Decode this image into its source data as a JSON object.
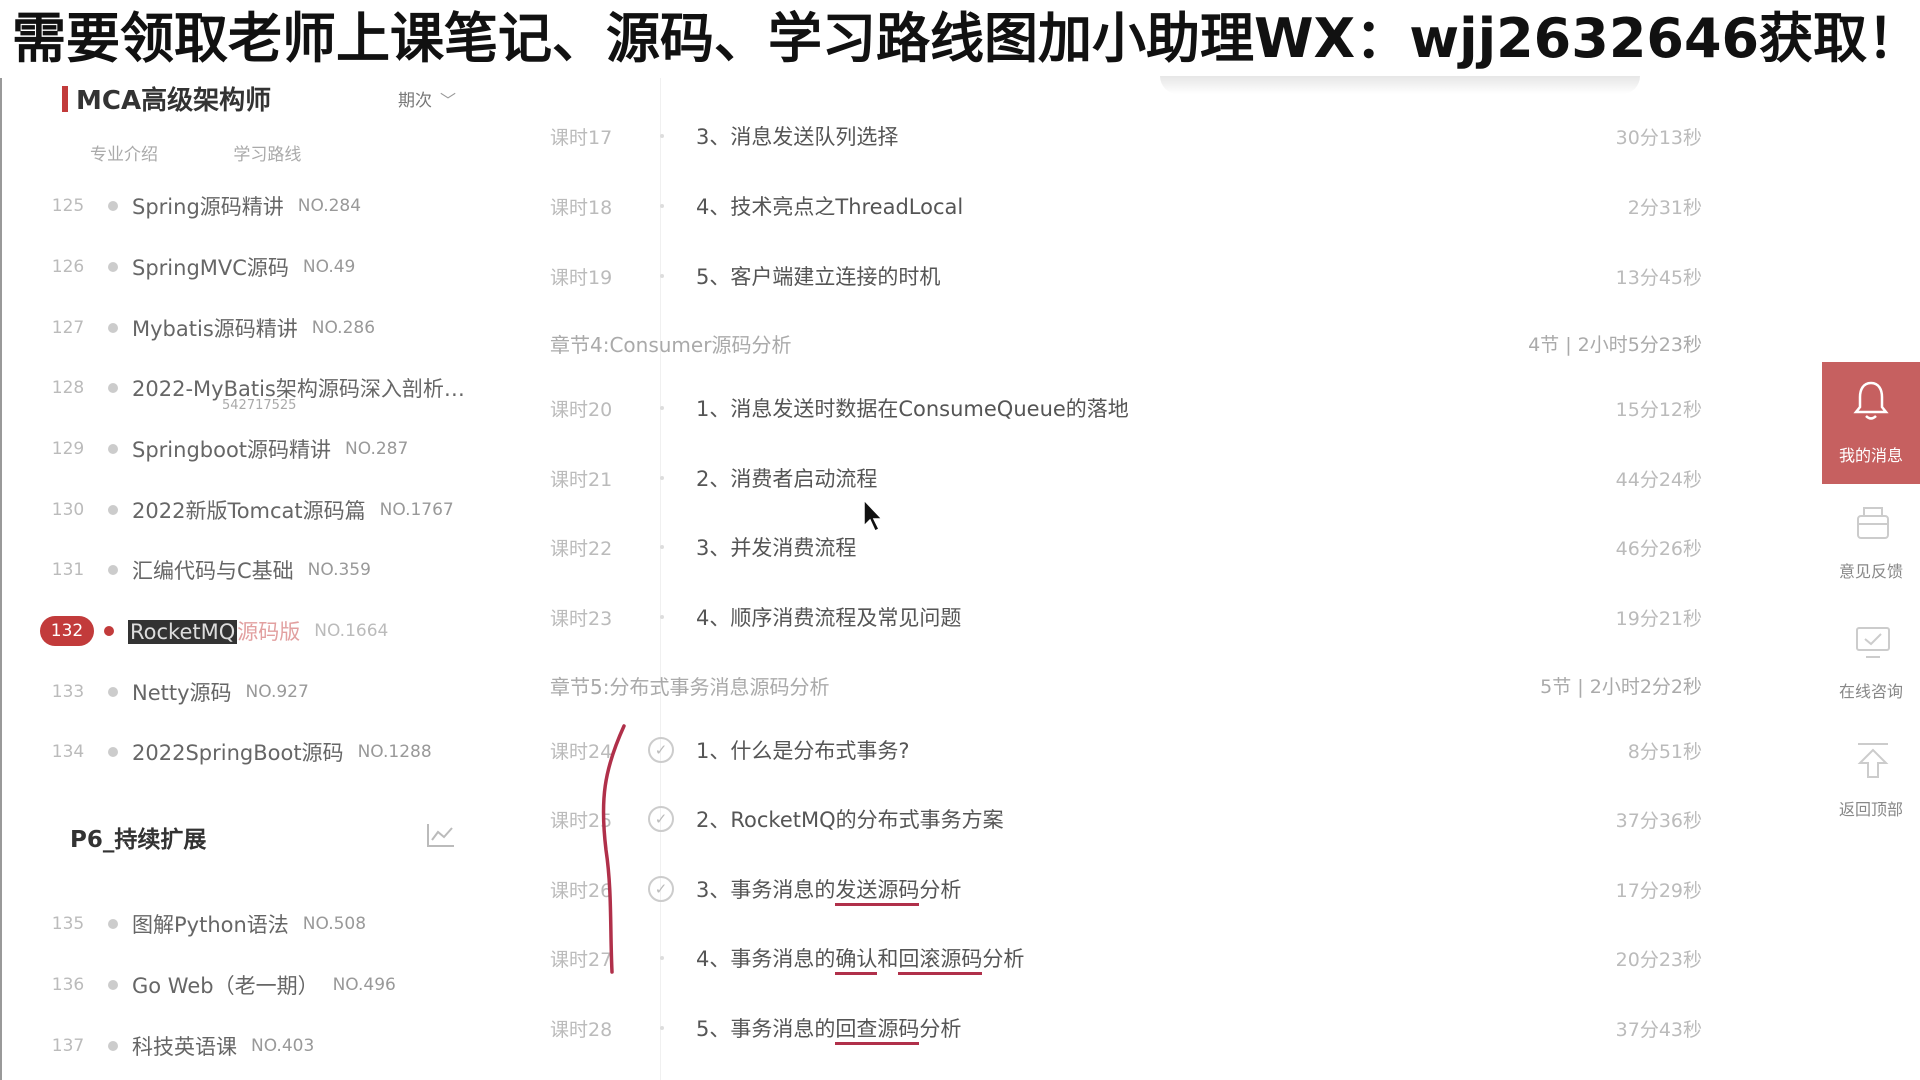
{
  "banner": "需要领取老师上课笔记、源码、学习路线图加小助理WX：wjj2632646获取！",
  "sidebar": {
    "title": "MCA高级架构师",
    "period": "期次",
    "sub_links": [
      "专业介绍",
      "学习路线"
    ],
    "courses": [
      {
        "num": "125",
        "name": "Spring源码精讲",
        "no": "NO.284"
      },
      {
        "num": "126",
        "name": "SpringMVC源码",
        "no": "NO.49"
      },
      {
        "num": "127",
        "name": "Mybatis源码精讲",
        "no": "NO.286"
      },
      {
        "num": "128",
        "name": "2022-MyBatis架构源码深入剖析…",
        "no": "",
        "sub": "542717525"
      },
      {
        "num": "129",
        "name": "Springboot源码精讲",
        "no": "NO.287"
      },
      {
        "num": "130",
        "name": "2022新版Tomcat源码篇",
        "no": "NO.1767"
      },
      {
        "num": "131",
        "name": "汇编代码与C基础",
        "no": "NO.359"
      },
      {
        "num": "132",
        "name_hl": "RocketMQ",
        "name_rest": "源码版",
        "no": "NO.1664"
      },
      {
        "num": "133",
        "name": "Netty源码",
        "no": "NO.927"
      },
      {
        "num": "134",
        "name": "2022SpringBoot源码",
        "no": "NO.1288"
      }
    ],
    "section2": "P6_持续扩展",
    "courses2": [
      {
        "num": "135",
        "name": "图解Python语法",
        "no": "NO.508"
      },
      {
        "num": "136",
        "name": "Go Web（老一期）",
        "no": "NO.496"
      },
      {
        "num": "137",
        "name": "科技英语课",
        "no": "NO.403"
      }
    ]
  },
  "main": {
    "rows": [
      {
        "lesson": "课时17",
        "title": "3、消息发送队列选择",
        "dur": "30分13秒"
      },
      {
        "lesson": "课时18",
        "title": "4、技术亮点之ThreadLocal",
        "dur": "2分31秒"
      },
      {
        "lesson": "课时19",
        "title": "5、客户端建立连接的时机",
        "dur": "13分45秒"
      },
      {
        "lesson": "课时20",
        "title": "1、消息发送时数据在ConsumeQueue的落地",
        "dur": "15分12秒"
      },
      {
        "lesson": "课时21",
        "title": "2、消费者启动流程",
        "dur": "44分24秒"
      },
      {
        "lesson": "课时22",
        "title": "3、并发消费流程",
        "dur": "46分26秒"
      },
      {
        "lesson": "课时23",
        "title": "4、顺序消费流程及常见问题",
        "dur": "19分21秒"
      },
      {
        "lesson": "课时24",
        "title": "1、什么是分布式事务?",
        "dur": "8分51秒"
      },
      {
        "lesson": "课时25",
        "title": "2、RocketMQ的分布式事务方案",
        "dur": "37分36秒"
      },
      {
        "lesson": "课时26",
        "t_a": "3、事务消息的",
        "t_b": "发送源码",
        "t_c": "分析",
        "dur": "17分29秒"
      },
      {
        "lesson": "课时27",
        "t_a": "4、事务消息的",
        "t_b": "确认",
        "t_m": "和",
        "t_d": "回滚源码",
        "t_c": "分析",
        "dur": "20分23秒"
      },
      {
        "lesson": "课时28",
        "t_a": "5、事务消息的",
        "t_b": "回查源码",
        "t_c": "分析",
        "dur": "37分43秒"
      }
    ],
    "chapters": [
      {
        "title": "章节4:Consumer源码分析",
        "summary": "4节 | 2小时5分23秒"
      },
      {
        "title": "章节5:分布式事务消息源码分析",
        "summary": "5节 | 2小时2分2秒"
      }
    ]
  },
  "tools": {
    "msg": "我的消息",
    "feedback": "意见反馈",
    "consult": "在线咨询",
    "top": "返回顶部"
  },
  "colors": {
    "accent": "#c23b3b",
    "msg_bg": "#c66060",
    "annotation": "#b0304a"
  }
}
